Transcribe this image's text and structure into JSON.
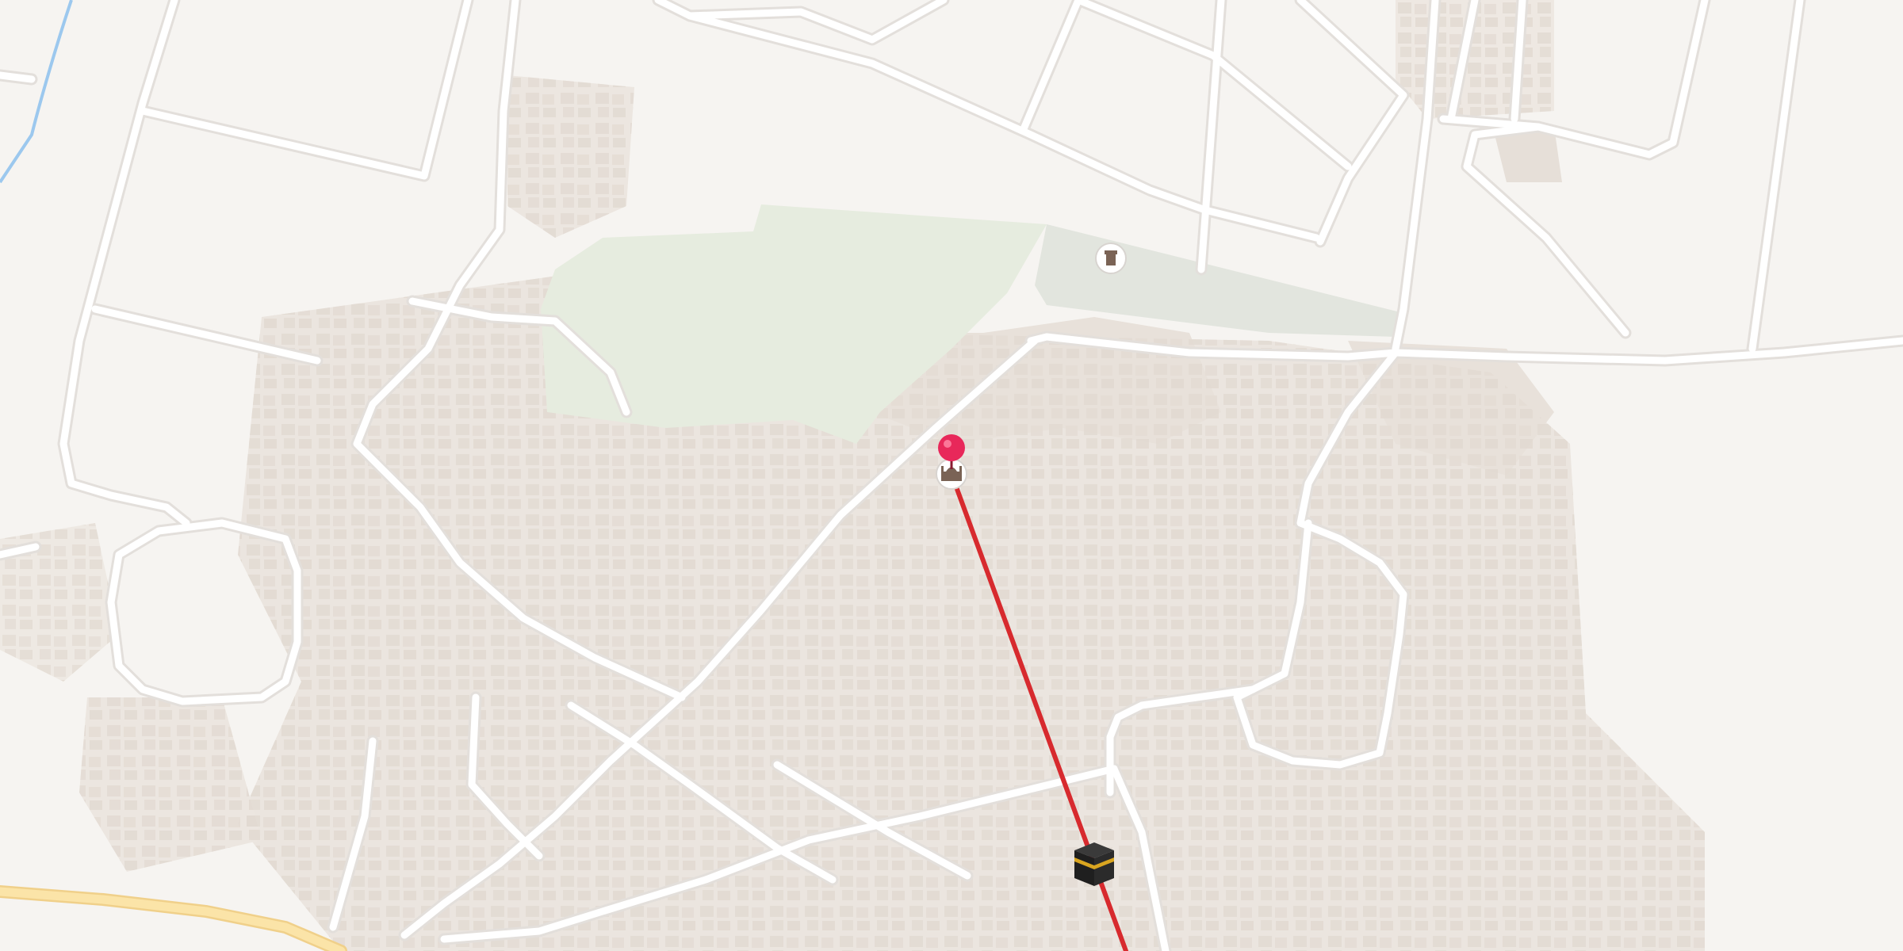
{
  "map": {
    "colors": {
      "land": "#f6f4f1",
      "block": "#ebe5df",
      "road": "#ffffff",
      "road_casing": "#e4e0dc",
      "park": "#e6ecdf",
      "park2": "#e2e5de",
      "highway": "#f8dfa0",
      "waterway": "#9cc8ee",
      "route": "#d72a2e",
      "pin": "#e8285a"
    }
  },
  "markers": [
    {
      "name": "dropped-pin",
      "icon": "map-pin-icon"
    },
    {
      "name": "mosque-poi",
      "icon": "mosque-icon"
    },
    {
      "name": "landmark-poi",
      "icon": "monument-icon"
    },
    {
      "name": "kaaba-marker",
      "icon": "kaaba-icon"
    }
  ],
  "route": {
    "name": "qibla-direction-line"
  }
}
